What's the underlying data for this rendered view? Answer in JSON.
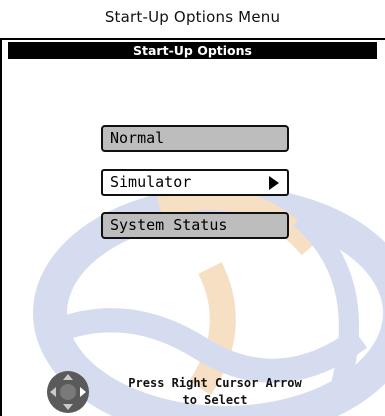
{
  "caption": "Start-Up Options Menu",
  "screen": {
    "title": "Start-Up Options",
    "options": [
      {
        "label": "Normal",
        "state": "unselected"
      },
      {
        "label": "Simulator",
        "state": "selected"
      },
      {
        "label": "System Status",
        "state": "unselected"
      }
    ],
    "hint": {
      "line1": "Press Right Cursor Arrow",
      "line2": "to Select"
    },
    "icons": {
      "selection_arrow": "right-arrow-icon",
      "cursor_pad": "cursor-pad-icon"
    }
  },
  "colors": {
    "title_bar": "#000000",
    "unselected_button": "#bdbdbd",
    "selected_button": "#ffffff",
    "watermark_blue": "#d6dcef",
    "watermark_orange": "#f7dfc4"
  }
}
